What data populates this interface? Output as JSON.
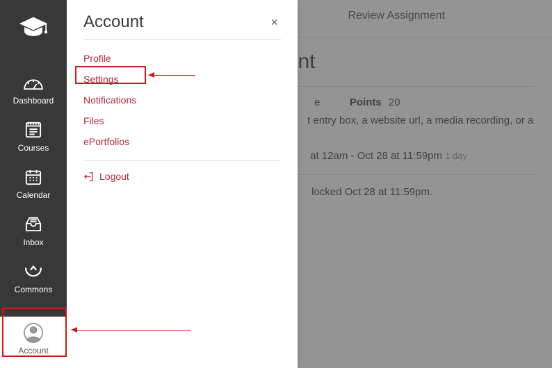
{
  "colors": {
    "brand_red": "#b9273e",
    "nav_bg": "#383838",
    "annotation": "#c61c1c"
  },
  "nav": {
    "items": [
      {
        "key": "dashboard",
        "label": "Dashboard"
      },
      {
        "key": "courses",
        "label": "Courses"
      },
      {
        "key": "calendar",
        "label": "Calendar"
      },
      {
        "key": "inbox",
        "label": "Inbox"
      },
      {
        "key": "commons",
        "label": "Commons"
      },
      {
        "key": "account",
        "label": "Account"
      }
    ]
  },
  "panel": {
    "title": "Account",
    "close_glyph": "×",
    "links": [
      {
        "key": "profile",
        "label": "Profile"
      },
      {
        "key": "settings",
        "label": "Settings"
      },
      {
        "key": "notifications",
        "label": "Notifications"
      },
      {
        "key": "files",
        "label": "Files"
      },
      {
        "key": "eportfolios",
        "label": "ePortfolios"
      }
    ],
    "logout_label": "Logout"
  },
  "page": {
    "breadcrumb_fragment": "Review Assignment",
    "title_fragment": "w Assignment",
    "meta_col1_fragment": "e",
    "points_label": "Points",
    "points_value": "20",
    "submit_fragment": "t entry box, a website url, a media recording, or a fi",
    "avail_fragment": " at 12am - Oct 28 at 11:59pm",
    "avail_trailing": "1 day",
    "lock_fragment": " locked Oct 28 at 11:59pm."
  }
}
